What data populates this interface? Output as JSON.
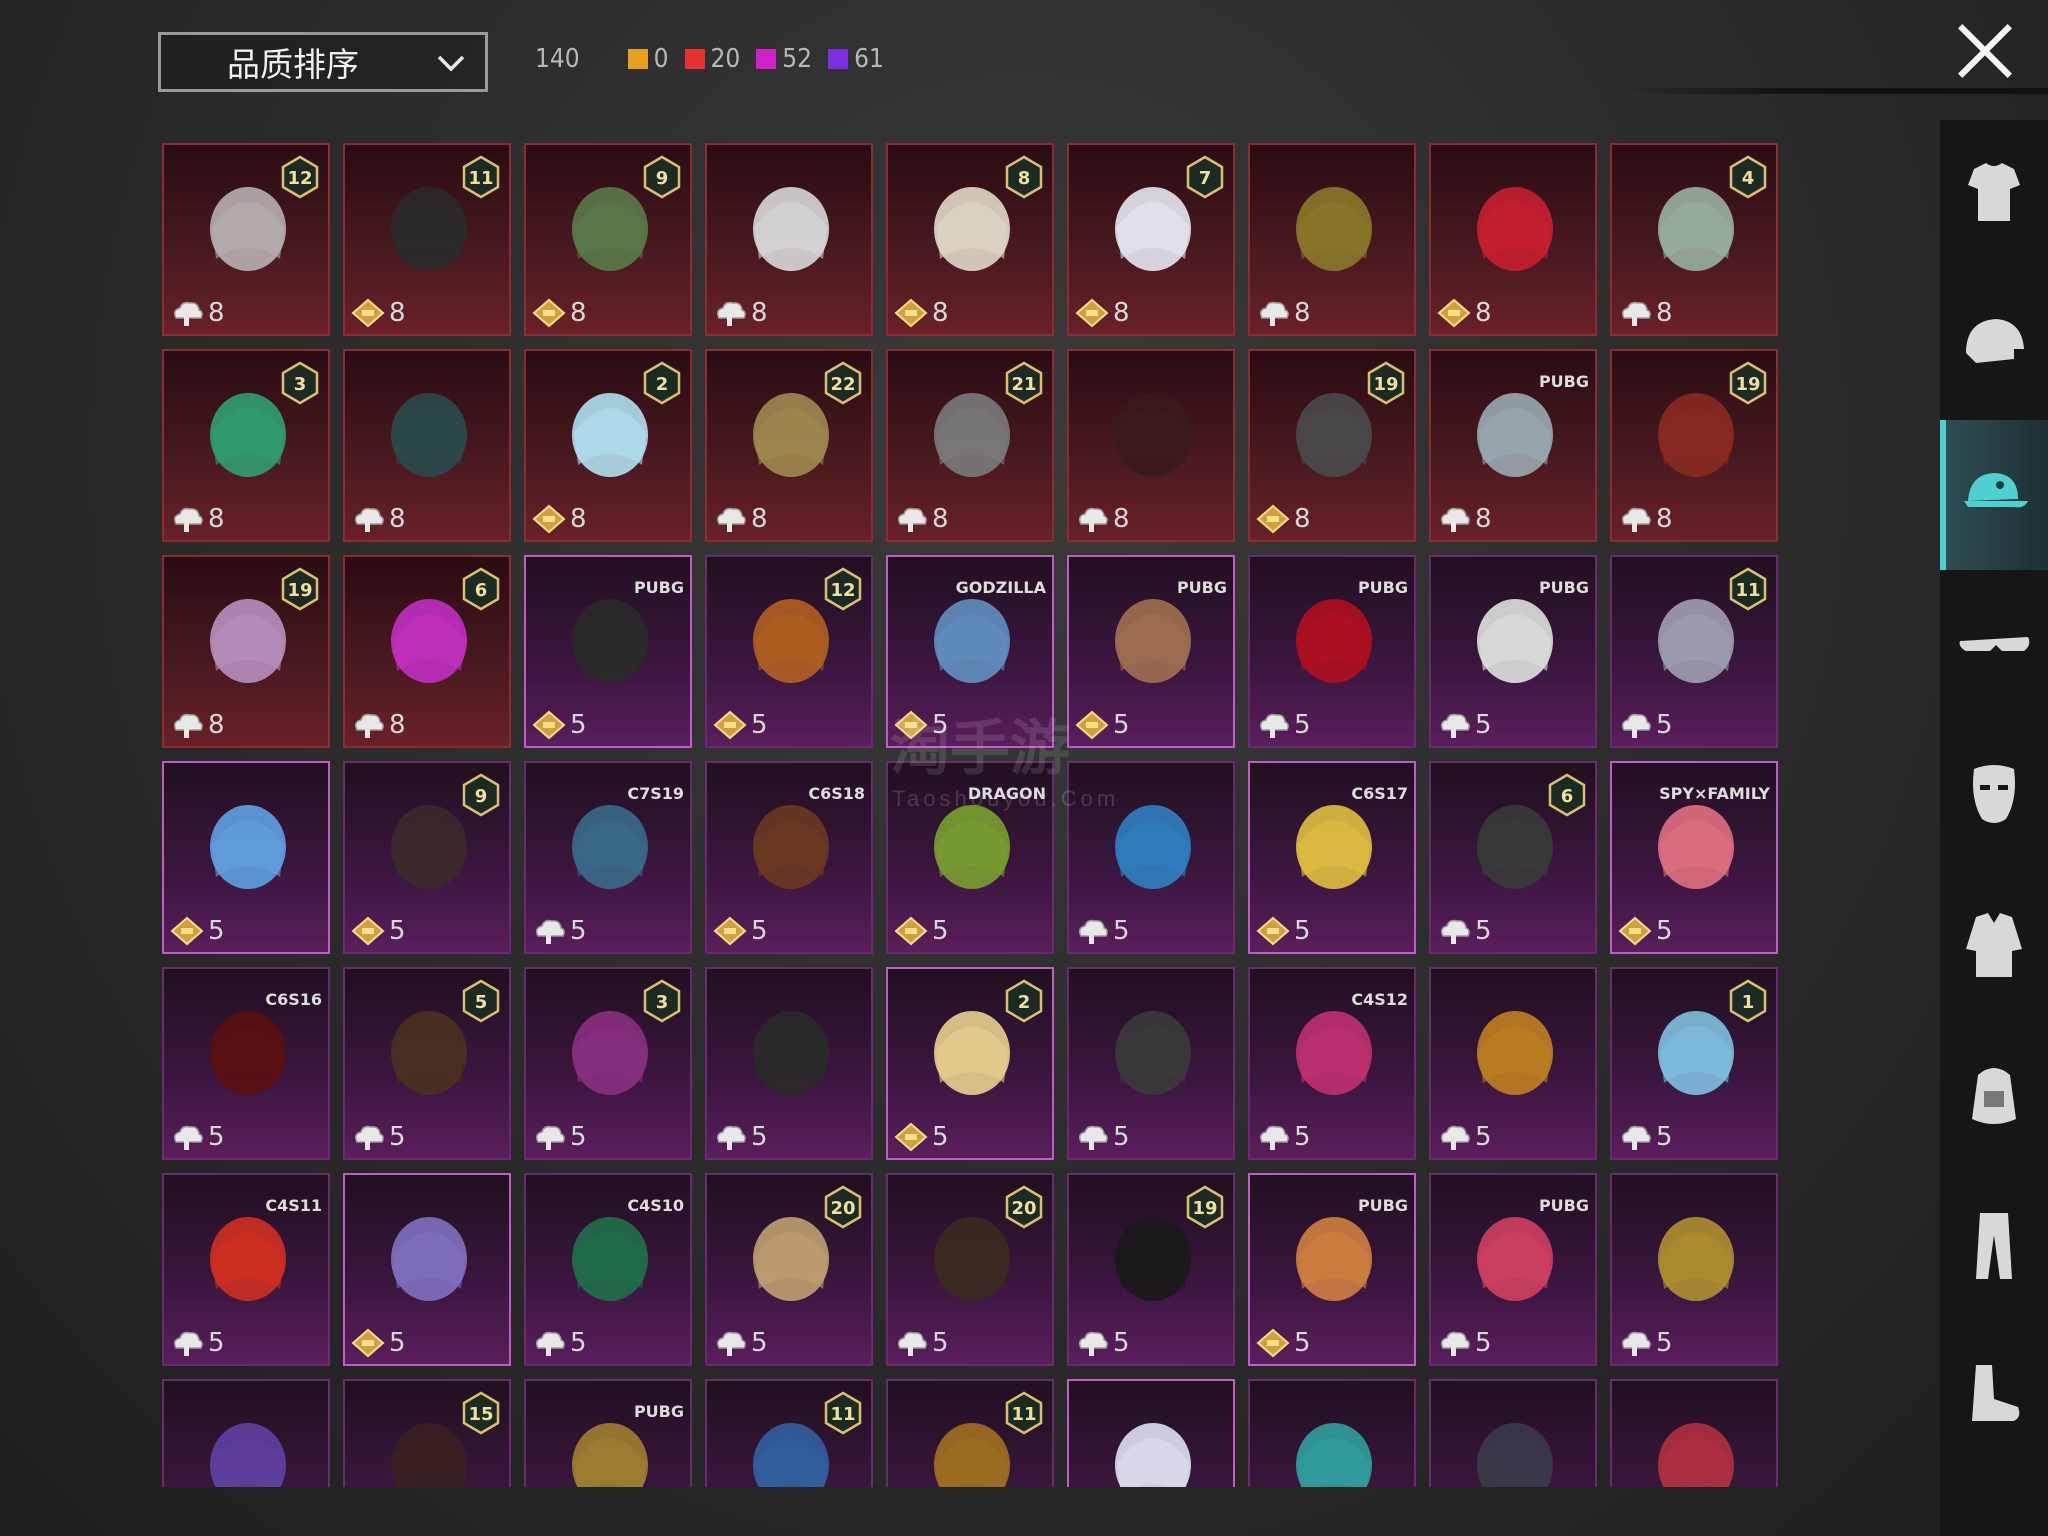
{
  "header": {
    "sort_label": "品质排序",
    "total_count": "140",
    "tiers": [
      {
        "color": "#e8a020",
        "count": "0"
      },
      {
        "color": "#e83030",
        "count": "20"
      },
      {
        "color": "#d020c8",
        "count": "52"
      },
      {
        "color": "#7a30e0",
        "count": "61"
      }
    ]
  },
  "watermark": {
    "text": "淘手游",
    "sub": "Taoshouyou.Com"
  },
  "sidebar": {
    "items": [
      {
        "name": "sidebar-item-outfit",
        "icon": "outfit-icon",
        "active": false
      },
      {
        "name": "sidebar-item-helmet",
        "icon": "helmet-icon",
        "active": false
      },
      {
        "name": "sidebar-item-headwear",
        "icon": "cap-icon",
        "active": true
      },
      {
        "name": "sidebar-item-glasses",
        "icon": "glasses-icon",
        "active": false
      },
      {
        "name": "sidebar-item-mask",
        "icon": "mask-icon",
        "active": false
      },
      {
        "name": "sidebar-item-top",
        "icon": "jacket-icon",
        "active": false
      },
      {
        "name": "sidebar-item-backpack",
        "icon": "backpack-icon",
        "active": false
      },
      {
        "name": "sidebar-item-pants",
        "icon": "pants-icon",
        "active": false
      },
      {
        "name": "sidebar-item-shoes",
        "icon": "shoes-icon",
        "active": false
      }
    ]
  },
  "items": [
    {
      "tier": "red",
      "badge": "12",
      "currency": "cloud",
      "value": "8",
      "art": "#b8b0b0"
    },
    {
      "tier": "red",
      "badge": "11",
      "currency": "diamond",
      "value": "8",
      "art": "#2a2a2a"
    },
    {
      "tier": "red",
      "badge": "9",
      "currency": "diamond",
      "value": "8",
      "art": "#5a7a4a"
    },
    {
      "tier": "red",
      "badge": "",
      "currency": "cloud",
      "value": "8",
      "art": "#d8d8d8"
    },
    {
      "tier": "red",
      "badge": "8",
      "currency": "diamond",
      "value": "8",
      "art": "#e0d8c8"
    },
    {
      "tier": "red",
      "badge": "7",
      "currency": "diamond",
      "value": "8",
      "art": "#e8e8f0"
    },
    {
      "tier": "red",
      "badge": "",
      "currency": "cloud",
      "value": "8",
      "art": "#8a7a2a"
    },
    {
      "tier": "red",
      "badge": "",
      "currency": "diamond",
      "value": "8",
      "art": "#c82030"
    },
    {
      "tier": "red",
      "badge": "4",
      "currency": "cloud",
      "value": "8",
      "art": "#9ab0a0"
    },
    {
      "tier": "red",
      "badge": "3",
      "currency": "cloud",
      "value": "8",
      "art": "#30a070"
    },
    {
      "tier": "red",
      "badge": "",
      "currency": "cloud",
      "value": "8",
      "art": "#2a4a4a"
    },
    {
      "tier": "red",
      "badge": "2",
      "currency": "diamond",
      "value": "8",
      "art": "#b0e0f0"
    },
    {
      "tier": "red",
      "badge": "22",
      "currency": "cloud",
      "value": "8",
      "art": "#a08a50"
    },
    {
      "tier": "red",
      "badge": "21",
      "currency": "cloud",
      "value": "8",
      "art": "#7a7a7a"
    },
    {
      "tier": "red",
      "badge": "",
      "currency": "cloud",
      "value": "8",
      "art": "#3a1a1a"
    },
    {
      "tier": "red",
      "badge": "19",
      "currency": "diamond",
      "value": "8",
      "art": "#4a4a4a"
    },
    {
      "tier": "red",
      "badge": "PUBG",
      "currency": "cloud",
      "value": "8",
      "art": "#9aaab0"
    },
    {
      "tier": "red",
      "badge": "19",
      "currency": "cloud",
      "value": "8",
      "art": "#8a2a20"
    },
    {
      "tier": "red",
      "badge": "19",
      "currency": "cloud",
      "value": "8",
      "art": "#b890c0"
    },
    {
      "tier": "red",
      "badge": "6",
      "currency": "cloud",
      "value": "8",
      "art": "#c030c0"
    },
    {
      "tier": "purple",
      "badge": "PUBG",
      "currency": "diamond",
      "value": "5",
      "art": "#2a2a2a",
      "hl": true
    },
    {
      "tier": "purple",
      "badge": "12",
      "currency": "diamond",
      "value": "5",
      "art": "#b06020"
    },
    {
      "tier": "purple",
      "badge": "GODZILLA",
      "currency": "diamond",
      "value": "5",
      "art": "#6090c0",
      "hl": true
    },
    {
      "tier": "purple",
      "badge": "PUBG",
      "currency": "diamond",
      "value": "5",
      "art": "#a07050",
      "hl": true
    },
    {
      "tier": "purple",
      "badge": "PUBG",
      "currency": "cloud",
      "value": "5",
      "art": "#b01020"
    },
    {
      "tier": "purple",
      "badge": "PUBG",
      "currency": "cloud",
      "value": "5",
      "art": "#e0e0e0"
    },
    {
      "tier": "purple",
      "badge": "11",
      "currency": "cloud",
      "value": "5",
      "art": "#a0a0b0"
    },
    {
      "tier": "purple",
      "badge": "",
      "currency": "diamond",
      "value": "5",
      "art": "#60a0e0",
      "hl": true
    },
    {
      "tier": "purple",
      "badge": "9",
      "currency": "diamond",
      "value": "5",
      "art": "#3a2a2a"
    },
    {
      "tier": "purple",
      "badge": "C7S19",
      "currency": "cloud",
      "value": "5",
      "art": "#3a6a8a"
    },
    {
      "tier": "purple",
      "badge": "C6S18",
      "currency": "diamond",
      "value": "5",
      "art": "#6a3a20"
    },
    {
      "tier": "purple",
      "badge": "DRAGON",
      "currency": "diamond",
      "value": "5",
      "art": "#7aa030"
    },
    {
      "tier": "purple",
      "badge": "",
      "currency": "cloud",
      "value": "5",
      "art": "#3080c0"
    },
    {
      "tier": "purple",
      "badge": "C6S17",
      "currency": "diamond",
      "value": "5",
      "art": "#e0c040",
      "hl": true
    },
    {
      "tier": "purple",
      "badge": "6",
      "currency": "cloud",
      "value": "5",
      "art": "#3a3a3a"
    },
    {
      "tier": "purple",
      "badge": "SPY×FAMILY",
      "currency": "diamond",
      "value": "5",
      "art": "#e07080",
      "hl": true
    },
    {
      "tier": "purple",
      "badge": "C6S16",
      "currency": "cloud",
      "value": "5",
      "art": "#5a1010"
    },
    {
      "tier": "purple",
      "badge": "5",
      "currency": "cloud",
      "value": "5",
      "art": "#4a3020"
    },
    {
      "tier": "purple",
      "badge": "3",
      "currency": "cloud",
      "value": "5",
      "art": "#8a3080"
    },
    {
      "tier": "purple",
      "badge": "",
      "currency": "cloud",
      "value": "5",
      "art": "#2a2a2a"
    },
    {
      "tier": "purple",
      "badge": "2",
      "currency": "diamond",
      "value": "5",
      "art": "#e8d090",
      "hl": true
    },
    {
      "tier": "purple",
      "badge": "",
      "currency": "cloud",
      "value": "5",
      "art": "#3a3a3a"
    },
    {
      "tier": "purple",
      "badge": "C4S12",
      "currency": "cloud",
      "value": "5",
      "art": "#c03070"
    },
    {
      "tier": "purple",
      "badge": "",
      "currency": "cloud",
      "value": "5",
      "art": "#c08020"
    },
    {
      "tier": "purple",
      "badge": "1",
      "currency": "cloud",
      "value": "5",
      "art": "#80c0e0"
    },
    {
      "tier": "purple",
      "badge": "C4S11",
      "currency": "cloud",
      "value": "5",
      "art": "#d03020"
    },
    {
      "tier": "purple",
      "badge": "",
      "currency": "diamond",
      "value": "5",
      "art": "#8070c0",
      "hl": true
    },
    {
      "tier": "purple",
      "badge": "C4S10",
      "currency": "cloud",
      "value": "5",
      "art": "#20704a"
    },
    {
      "tier": "purple",
      "badge": "20",
      "currency": "cloud",
      "value": "5",
      "art": "#c0a070"
    },
    {
      "tier": "purple",
      "badge": "20",
      "currency": "cloud",
      "value": "5",
      "art": "#3a2a20"
    },
    {
      "tier": "purple",
      "badge": "19",
      "currency": "cloud",
      "value": "5",
      "art": "#1a1a1a"
    },
    {
      "tier": "purple",
      "badge": "PUBG",
      "currency": "diamond",
      "value": "5",
      "art": "#d08040",
      "hl": true
    },
    {
      "tier": "purple",
      "badge": "PUBG",
      "currency": "cloud",
      "value": "5",
      "art": "#d04060"
    },
    {
      "tier": "purple",
      "badge": "",
      "currency": "cloud",
      "value": "5",
      "art": "#b09030"
    },
    {
      "tier": "purple",
      "badge": "",
      "currency": "",
      "value": "",
      "art": "#6040a0"
    },
    {
      "tier": "purple",
      "badge": "15",
      "currency": "",
      "value": "",
      "art": "#3a2020"
    },
    {
      "tier": "purple",
      "badge": "PUBG",
      "currency": "",
      "value": "",
      "art": "#a08030"
    },
    {
      "tier": "purple",
      "badge": "11",
      "currency": "",
      "value": "",
      "art": "#3060a0"
    },
    {
      "tier": "purple",
      "badge": "11",
      "currency": "",
      "value": "",
      "art": "#a07020"
    },
    {
      "tier": "purple",
      "badge": "",
      "currency": "",
      "value": "",
      "art": "#e0e0f0",
      "hl": true
    },
    {
      "tier": "purple",
      "badge": "",
      "currency": "",
      "value": "",
      "art": "#30a0a0"
    },
    {
      "tier": "purple",
      "badge": "",
      "currency": "",
      "value": "",
      "art": "#3a3a4a"
    },
    {
      "tier": "purple",
      "badge": "",
      "currency": "",
      "value": "",
      "art": "#b03040"
    }
  ]
}
